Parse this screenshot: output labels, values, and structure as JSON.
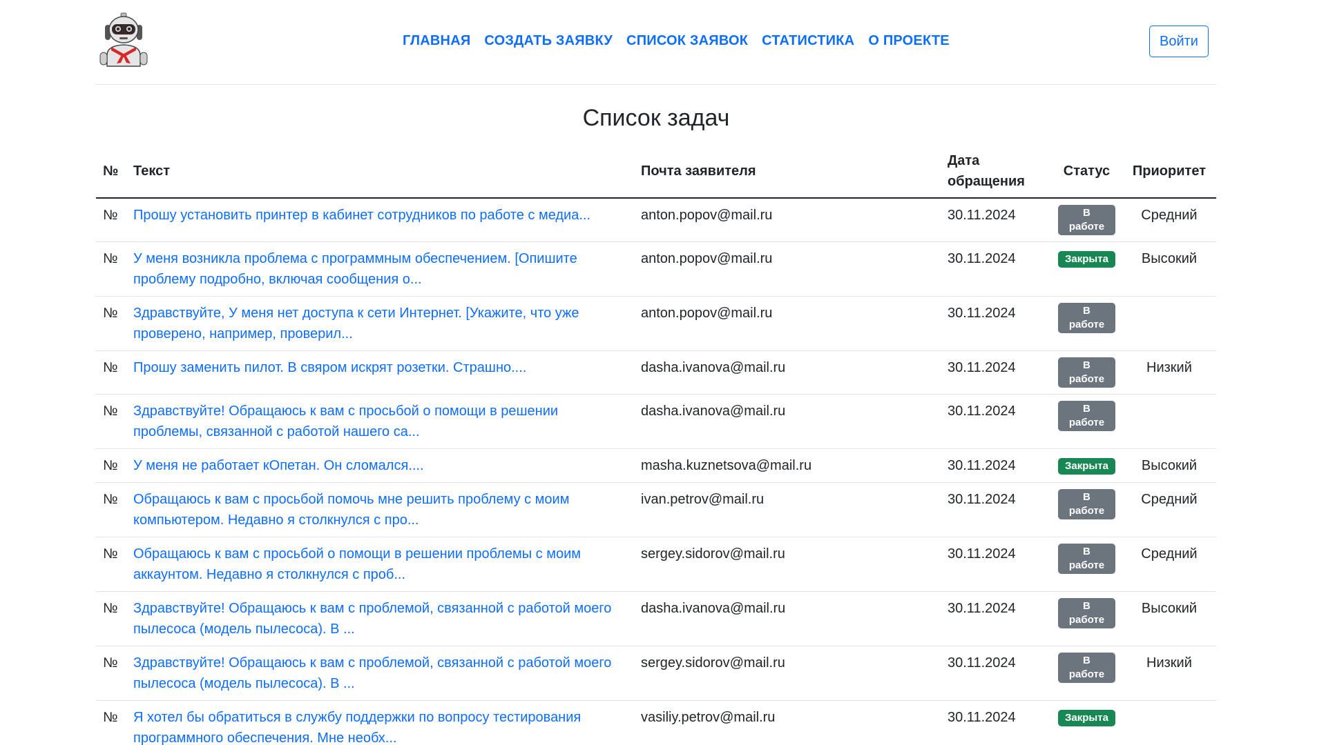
{
  "nav": {
    "items": [
      "ГЛАВНАЯ",
      "СОЗДАТЬ ЗАЯВКУ",
      "СПИСОК ЗАЯВОК",
      "СТАТИСТИКА",
      "О ПРОЕКТЕ"
    ],
    "login": "Войти"
  },
  "page_title": "Список задач",
  "table": {
    "headers": {
      "num": "№",
      "text": "Текст",
      "email": "Почта заявителя",
      "date": "Дата обращения",
      "status": "Статус",
      "priority": "Приоритет"
    },
    "rows": [
      {
        "num": "№",
        "text": "Прошу установить принтер в кабинет сотрудников по работе с медиа...",
        "email": "anton.popov@mail.ru",
        "date": "30.11.2024",
        "status": "В работе",
        "status_kind": "work",
        "priority": "Средний"
      },
      {
        "num": "№",
        "text": "У меня возникла проблема с программным обеспечением. [Опишите проблему подробно, включая сообщения о...",
        "email": "anton.popov@mail.ru",
        "date": "30.11.2024",
        "status": "Закрыта",
        "status_kind": "closed",
        "priority": "Высокий"
      },
      {
        "num": "№",
        "text": "Здравствуйте, У меня нет доступа к сети Интернет. [Укажите, что уже проверено, например, проверил...",
        "email": "anton.popov@mail.ru",
        "date": "30.11.2024",
        "status": "В работе",
        "status_kind": "work",
        "priority": ""
      },
      {
        "num": "№",
        "text": "Прошу заменить пилот. В свяром искрят розетки. Страшно....",
        "email": "dasha.ivanova@mail.ru",
        "date": "30.11.2024",
        "status": "В работе",
        "status_kind": "work",
        "priority": "Низкий"
      },
      {
        "num": "№",
        "text": "Здравствуйте! Обращаюсь к вам с просьбой о помощи в решении проблемы, связанной с работой нашего са...",
        "email": "dasha.ivanova@mail.ru",
        "date": "30.11.2024",
        "status": "В работе",
        "status_kind": "work",
        "priority": ""
      },
      {
        "num": "№",
        "text": "У меня не работает кОпетан. Он сломался....",
        "email": "masha.kuznetsova@mail.ru",
        "date": "30.11.2024",
        "status": "Закрыта",
        "status_kind": "closed",
        "priority": "Высокий"
      },
      {
        "num": "№",
        "text": "Обращаюсь к вам с просьбой помочь мне решить проблему с моим компьютером. Недавно я столкнулся с про...",
        "email": "ivan.petrov@mail.ru",
        "date": "30.11.2024",
        "status": "В работе",
        "status_kind": "work",
        "priority": "Средний"
      },
      {
        "num": "№",
        "text": "Обращаюсь к вам с просьбой о помощи в решении проблемы с моим аккаунтом. Недавно я столкнулся с проб...",
        "email": "sergey.sidorov@mail.ru",
        "date": "30.11.2024",
        "status": "В работе",
        "status_kind": "work",
        "priority": "Средний"
      },
      {
        "num": "№",
        "text": "Здравствуйте! Обращаюсь к вам с проблемой, связанной с работой моего пылесоса (модель пылесоса). В ...",
        "email": "dasha.ivanova@mail.ru",
        "date": "30.11.2024",
        "status": "В работе",
        "status_kind": "work",
        "priority": "Высокий"
      },
      {
        "num": "№",
        "text": "Здравствуйте! Обращаюсь к вам с проблемой, связанной с работой моего пылесоса (модель пылесоса). В ...",
        "email": "sergey.sidorov@mail.ru",
        "date": "30.11.2024",
        "status": "В работе",
        "status_kind": "work",
        "priority": "Низкий"
      },
      {
        "num": "№",
        "text": "Я хотел бы обратиться в службу поддержки по вопросу тестирования программного обеспечения. Мне необх...",
        "email": "vasiliy.petrov@mail.ru",
        "date": "30.11.2024",
        "status": "Закрыта",
        "status_kind": "closed",
        "priority": ""
      }
    ]
  },
  "colors": {
    "link": "#0d6efd",
    "badge_work": "#6c757d",
    "badge_closed": "#198754"
  }
}
